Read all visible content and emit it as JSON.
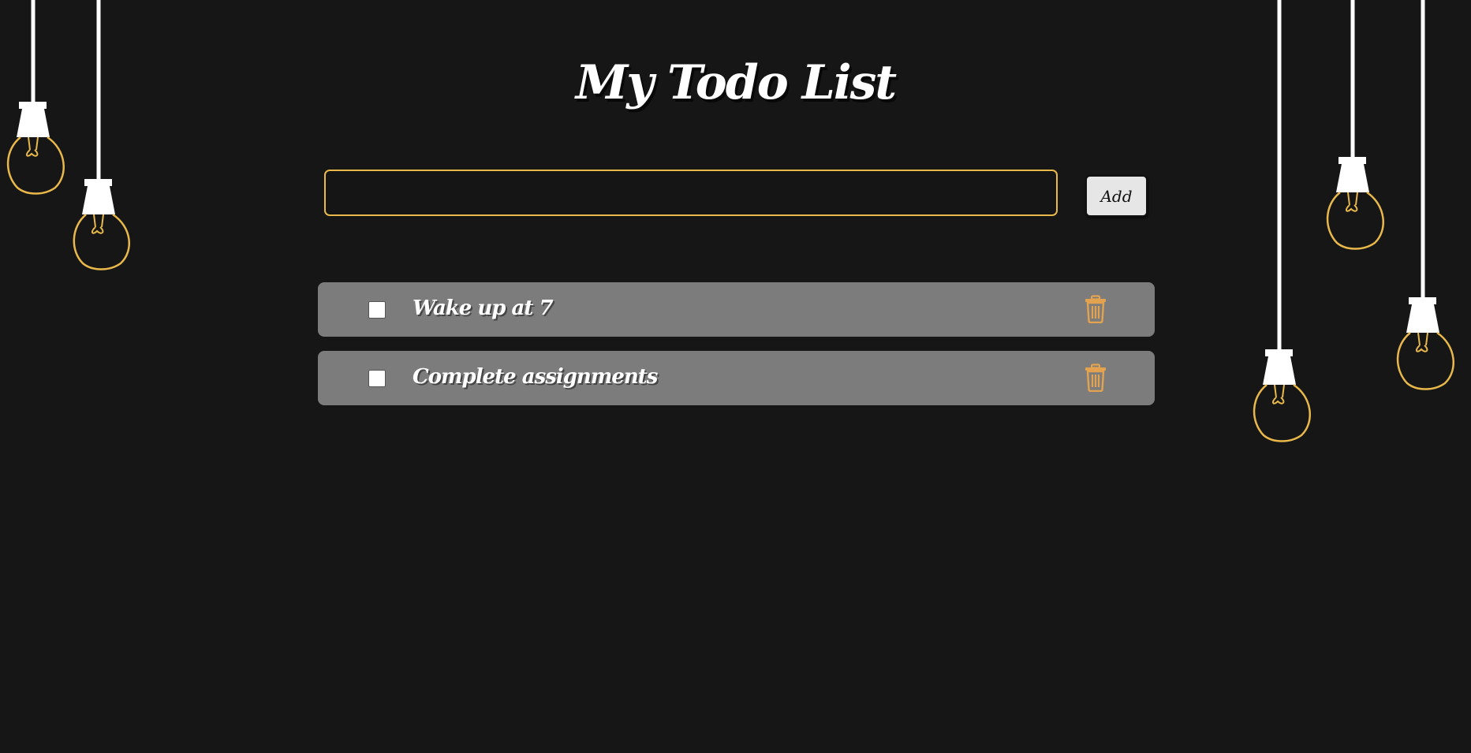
{
  "page": {
    "title": "My Todo List"
  },
  "form": {
    "input_value": "",
    "input_placeholder": "",
    "add_label": "Add"
  },
  "todos": [
    {
      "text": "Wake up at 7",
      "done": false
    },
    {
      "text": "Complete assignments",
      "done": false
    }
  ],
  "icons": {
    "delete": "trash-icon",
    "decoration": "light-bulb-icon"
  },
  "colors": {
    "background": "#161616",
    "accent": "#e8b84a",
    "item_background": "#7c7c7c",
    "delete_icon": "#e3a24f",
    "title_text": "#ffffff"
  }
}
